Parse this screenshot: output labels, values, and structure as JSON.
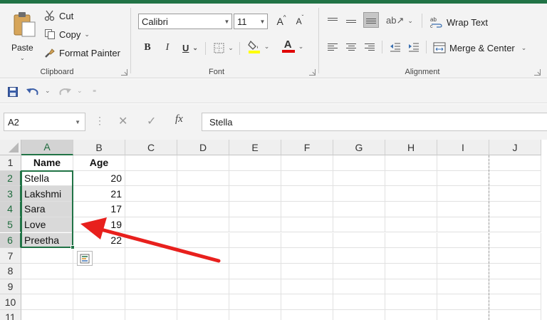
{
  "clipboard": {
    "paste_label": "Paste",
    "cut_label": "Cut",
    "copy_label": "Copy",
    "format_painter_label": "Format Painter",
    "group_label": "Clipboard"
  },
  "font": {
    "font_name": "Calibri",
    "font_size": "11",
    "grow_label": "A",
    "shrink_label": "A",
    "bold_label": "B",
    "italic_label": "I",
    "underline_label": "U",
    "font_color_label": "A",
    "group_label": "Font"
  },
  "alignment": {
    "wrap_text_label": "Wrap Text",
    "merge_center_label": "Merge & Center",
    "group_label": "Alignment"
  },
  "formula_bar": {
    "name_box": "A2",
    "fx_label": "fx",
    "formula_value": "Stella"
  },
  "sheet": {
    "columns": [
      "A",
      "B",
      "C",
      "D",
      "E",
      "F",
      "G",
      "H",
      "I",
      "J"
    ],
    "rows": [
      "1",
      "2",
      "3",
      "4",
      "5",
      "6",
      "7",
      "8",
      "9",
      "10",
      "11"
    ],
    "header_a": "Name",
    "header_b": "Age",
    "names": [
      "Stella",
      "Lakshmi",
      "Sara",
      "Love",
      "Preetha"
    ],
    "ages": [
      "20",
      "21",
      "17",
      "19",
      "22"
    ]
  },
  "colors": {
    "excel_green": "#217346",
    "arrow_red": "#e8201d",
    "selection_fill": "#d9d9d9",
    "font_color_bar": "#e00000",
    "highlight_bar": "#ffff00"
  },
  "annotation": {
    "arrow_icon": "red-arrow-icon"
  }
}
